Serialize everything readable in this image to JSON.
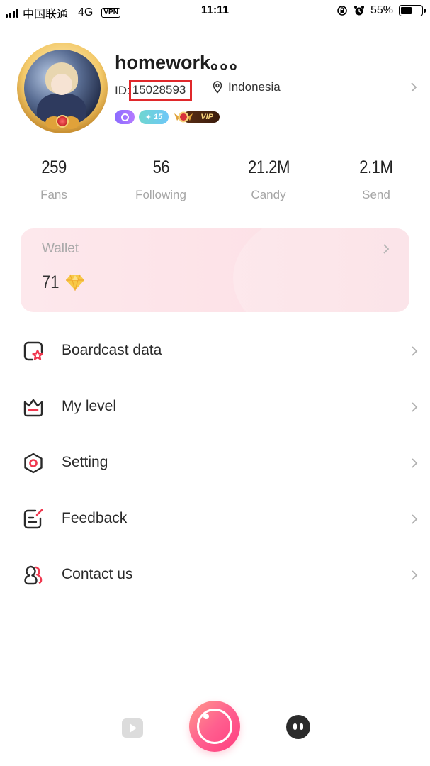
{
  "status_bar": {
    "carrier": "中国联通",
    "network": "4G",
    "vpn": "VPN",
    "time": "11:11",
    "battery": "55%",
    "battery_level": 0.55
  },
  "profile": {
    "username": "homework。。。",
    "id_prefix": "ID:",
    "id_value": "15028593",
    "location": "Indonesia",
    "level_badge": "15",
    "vip_badge": "VIP"
  },
  "stats": [
    {
      "value": "259",
      "label": "Fans"
    },
    {
      "value": "56",
      "label": "Following"
    },
    {
      "value": "21.2M",
      "label": "Candy"
    },
    {
      "value": "2.1M",
      "label": "Send"
    }
  ],
  "wallet": {
    "title": "Wallet",
    "balance": "71"
  },
  "menu": [
    {
      "label": "Boardcast data",
      "icon": "broadcast-data-icon"
    },
    {
      "label": "My level",
      "icon": "level-icon"
    },
    {
      "label": "Setting",
      "icon": "setting-icon"
    },
    {
      "label": "Feedback",
      "icon": "feedback-icon"
    },
    {
      "label": "Contact us",
      "icon": "contact-icon"
    }
  ],
  "colors": {
    "accent": "#f0384f",
    "highlight_box": "#e0282b",
    "wallet_bg": "#fde6ea"
  }
}
